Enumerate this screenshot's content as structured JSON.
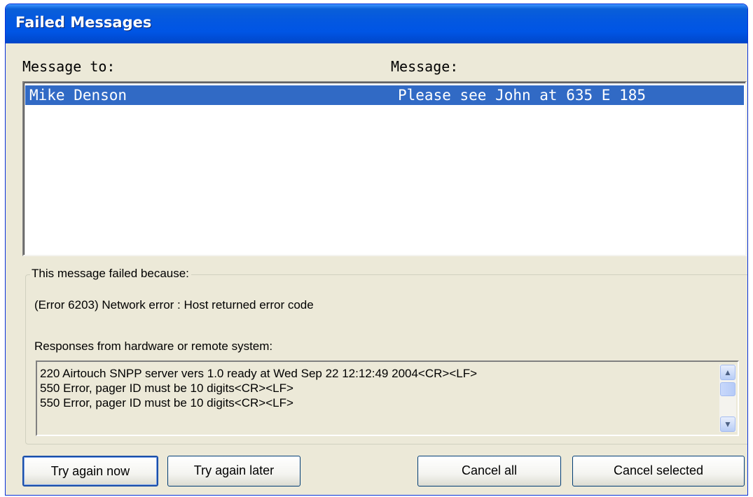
{
  "window": {
    "title": "Failed Messages"
  },
  "list": {
    "col_to_label": "Message to:",
    "col_message_label": "Message:",
    "rows": [
      {
        "to": "Mike Denson",
        "message": "Please see John at 635 E 185",
        "selected": true
      }
    ]
  },
  "failure": {
    "group_label": "This message failed because:",
    "error_text": "(Error 6203) Network error : Host returned error code",
    "responses_label": "Responses from hardware or remote system:",
    "responses": [
      "220 Airtouch SNPP server vers 1.0 ready at Wed Sep 22 12:12:49 2004<CR><LF>",
      "550 Error, pager ID must be 10 digits<CR><LF>",
      "550 Error, pager ID must be 10 digits<CR><LF>"
    ]
  },
  "buttons": {
    "try_now": "Try again now",
    "try_later": "Try again later",
    "cancel_all": "Cancel all",
    "cancel_selected": "Cancel selected"
  },
  "icons": {
    "scroll_up": "chevron-up-icon",
    "scroll_down": "chevron-down-icon"
  },
  "colors": {
    "titlebar": "#0055e5",
    "selection": "#316ac5",
    "window_bg": "#ece9d8"
  }
}
